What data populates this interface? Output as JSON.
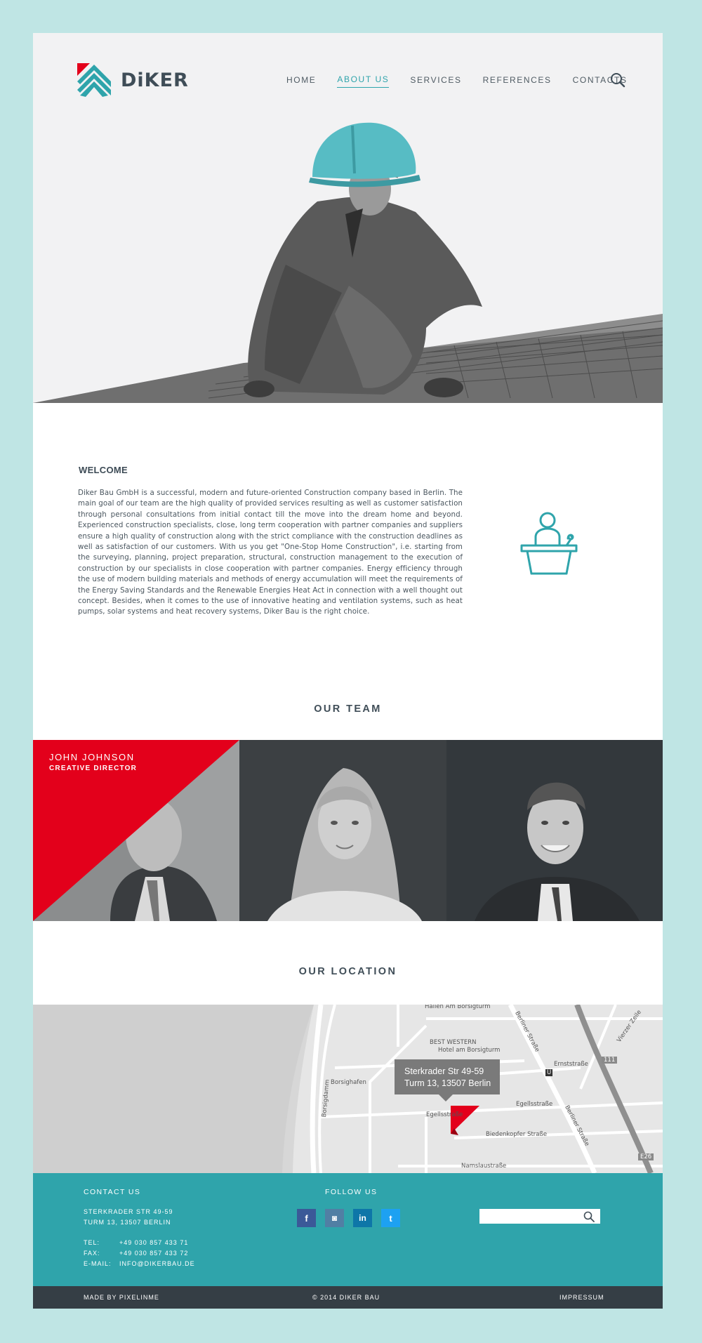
{
  "brand": {
    "name": "DiKER",
    "accent": "#2fa4ab",
    "red": "#e3001b"
  },
  "nav": {
    "items": [
      {
        "label": "HOME",
        "active": false
      },
      {
        "label": "ABOUT US",
        "active": true
      },
      {
        "label": "SERVICES",
        "active": false
      },
      {
        "label": "REFERENCES",
        "active": false
      },
      {
        "label": "CONTACTS",
        "active": false
      }
    ],
    "search_icon": "search-icon"
  },
  "welcome": {
    "title": "WELCOME",
    "body": "Diker Bau GmbH is a successful, modern and future-oriented Construction company based in Berlin. The main goal of our team are the high quality of provided services resulting as well as customer satisfaction through personal consultations from initial contact till the move into the dream home and beyond. Experienced construction specialists, close, long term cooperation with partner companies and suppliers ensure a high quality of construction along with the strict compliance with the construction deadlines as well as satisfaction of our customers. With us you get \"One-Stop Home Construction\", i.e. starting from the surveying, planning, project preparation, structural, construction management to the execution of construction by our specialists in close cooperation with partner companies. Energy efficiency through the use of modern building materials and methods of energy accumulation will meet the requirements of the Energy Saving Standards and the Renewable Energies Heat Act in connection with a well thought out concept. Besides, when it comes to the use of innovative heating and ventilation systems, such as heat pumps, solar systems and heat recovery systems, Diker Bau is the right choice.",
    "icon": "speaker-podium-icon"
  },
  "team": {
    "title": "OUR TEAM",
    "members": [
      {
        "name": "JOHN JOHNSON",
        "role": "CREATIVE DIRECTOR"
      },
      {
        "name": "",
        "role": ""
      },
      {
        "name": "",
        "role": ""
      }
    ]
  },
  "location": {
    "title": "OUR LOCATION",
    "bubble_line1": "Sterkrader Str 49-59",
    "bubble_line2": "Turm 13, 13507 Berlin",
    "streets": {
      "hallen": "Hallen Am Borsigturm",
      "hotel1": "BEST WESTERN",
      "hotel2": "Hotel am Borsigturm",
      "borsighafen": "Borsighafen",
      "borsigdamm": "Borsigdamm",
      "egellsstrasse1": "Egellsstraße",
      "egellsstrasse2": "Egellsstraße",
      "ernststrasse": "Ernststraße",
      "biedenkopfer": "Biedenkopfer Straße",
      "namslau": "Namslaustraße",
      "berliner1": "Berliner Straße",
      "berliner2": "Berliner Straße",
      "vierzehn": "Vierzer Zeile",
      "b111": "111",
      "e26": "E26",
      "u": "U"
    }
  },
  "footer": {
    "contact_title": "CONTACT US",
    "address1": "STERKRADER STR 49-59",
    "address2": "TURM 13, 13507 BERLIN",
    "tel_label": "TEL:",
    "tel": "+49 030 857 433 71",
    "fax_label": "FAX:",
    "fax": "+49 030 857 433 72",
    "email_label": "E-MAIL:",
    "email": "INFO@DIKERBAU.DE",
    "follow_title": "FOLLOW US",
    "socials": [
      {
        "icon": "facebook-icon",
        "glyph": "f",
        "color": "#3b5998"
      },
      {
        "icon": "instagram-icon",
        "glyph": "◙",
        "color": "#517fa4"
      },
      {
        "icon": "linkedin-icon",
        "glyph": "in",
        "color": "#0e76a8"
      },
      {
        "icon": "twitter-icon",
        "glyph": "t",
        "color": "#1da1f2"
      }
    ],
    "search_placeholder": ""
  },
  "bottom": {
    "made_by": "MADE BY PIXELINME",
    "copyright": "© 2014   DIKER BAU",
    "impressum": "IMPRESSUM"
  }
}
